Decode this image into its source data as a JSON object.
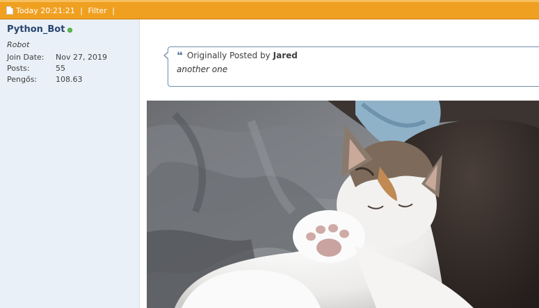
{
  "post_header": {
    "date_label": "Today 20:21:21",
    "separator1": "|",
    "filter_label": "Filter",
    "separator2": "|"
  },
  "user": {
    "username": "Python_Bot",
    "status": "online",
    "title": "Robot",
    "info": [
      {
        "key": "Join Date:",
        "value": "Nov 27, 2019"
      },
      {
        "key": "Posts:",
        "value": "55"
      },
      {
        "key": "Pengős:",
        "value": "108.63"
      }
    ]
  },
  "quote": {
    "prefix": "Originally Posted by",
    "author": "Jared",
    "text": "another one"
  },
  "image": {
    "subject": "calico-cat-sleeping-on-blanket-photo"
  },
  "colors": {
    "header": "#f0a020",
    "sidebar": "#e9f0f7",
    "username": "#27466f",
    "online": "#5cbf4e",
    "quote_border": "#6e8cab"
  }
}
